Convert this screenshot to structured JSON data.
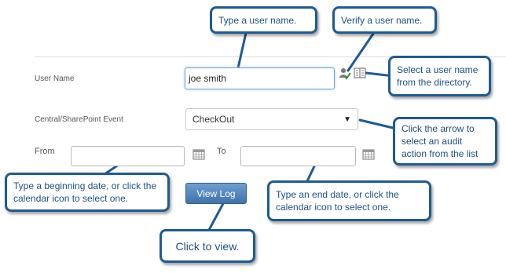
{
  "form": {
    "user_name_label": "User Name",
    "user_name_value": "joe smith",
    "event_label": "Central/SharePoint Event",
    "event_value": "CheckOut",
    "from_label": "From",
    "from_value": "",
    "to_label": "To",
    "to_value": "",
    "view_log_label": "View Log"
  },
  "callouts": {
    "type_user": "Type a user name.",
    "verify_user": "Verify a user name.",
    "select_user": "Select a user name from the directory.",
    "arrow_select": "Click the arrow to select an audit action from the list",
    "begin_date": "Type a beginning date, or click the calendar icon to select one.",
    "end_date": "Type an end date, or click the calendar icon to select one.",
    "click_view": "Click to view."
  },
  "icons": {
    "verify": "check-user-icon",
    "directory": "address-book-icon",
    "calendar": "calendar-icon",
    "dropdown": "dropdown-arrow-icon"
  },
  "colors": {
    "callout_border": "#1e5b93",
    "callout_text": "#1d4f82",
    "button": "#4a7fb8"
  }
}
